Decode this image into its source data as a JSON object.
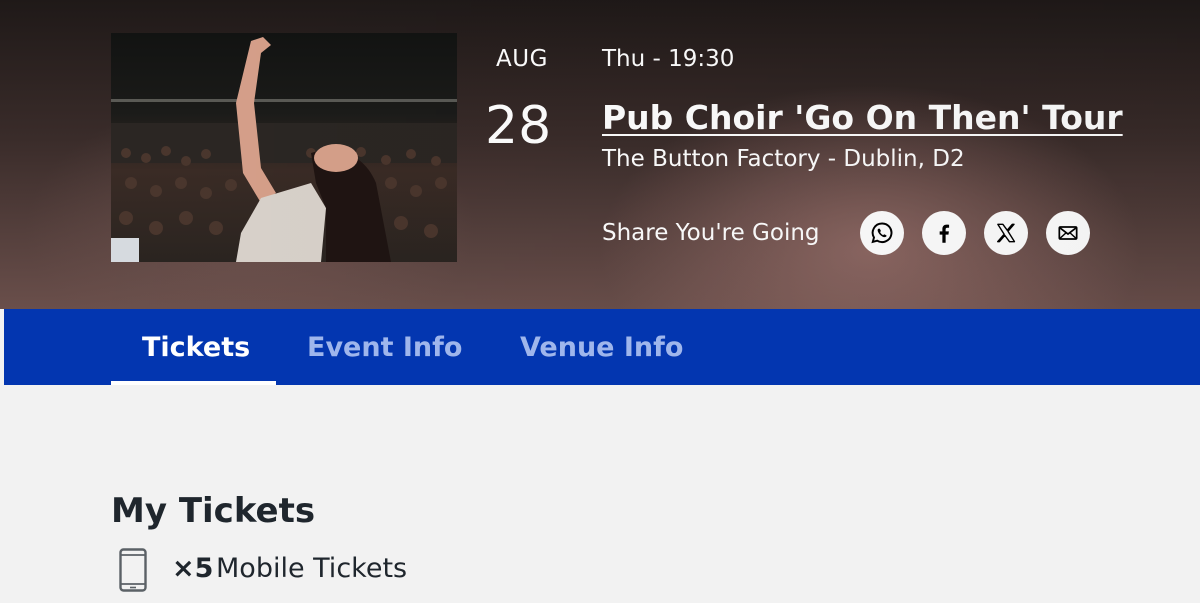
{
  "event": {
    "month": "AUG",
    "day": "28",
    "time": "Thu - 19:30",
    "title": "Pub Choir 'Go On Then' Tour",
    "venue": "The Button Factory - Dublin, D2",
    "image_icon": "performer-photo"
  },
  "share": {
    "label": "Share You're Going",
    "buttons": [
      {
        "name": "whatsapp",
        "icon": "whatsapp-icon"
      },
      {
        "name": "facebook",
        "icon": "facebook-icon"
      },
      {
        "name": "x",
        "icon": "x-icon"
      },
      {
        "name": "email",
        "icon": "email-icon"
      }
    ]
  },
  "tabs": [
    {
      "label": "Tickets",
      "active": true
    },
    {
      "label": "Event Info",
      "active": false
    },
    {
      "label": "Venue Info",
      "active": false
    }
  ],
  "tickets": {
    "heading": "My Tickets",
    "count": "×5",
    "type": "Mobile Tickets",
    "icon": "mobile-phone-icon"
  },
  "colors": {
    "nav_background": "#0336b0",
    "nav_active_text": "#ffffff",
    "nav_inactive_text": "#9fb6ec",
    "page_background": "#f2f2f2",
    "heading_text": "#1f262d"
  }
}
